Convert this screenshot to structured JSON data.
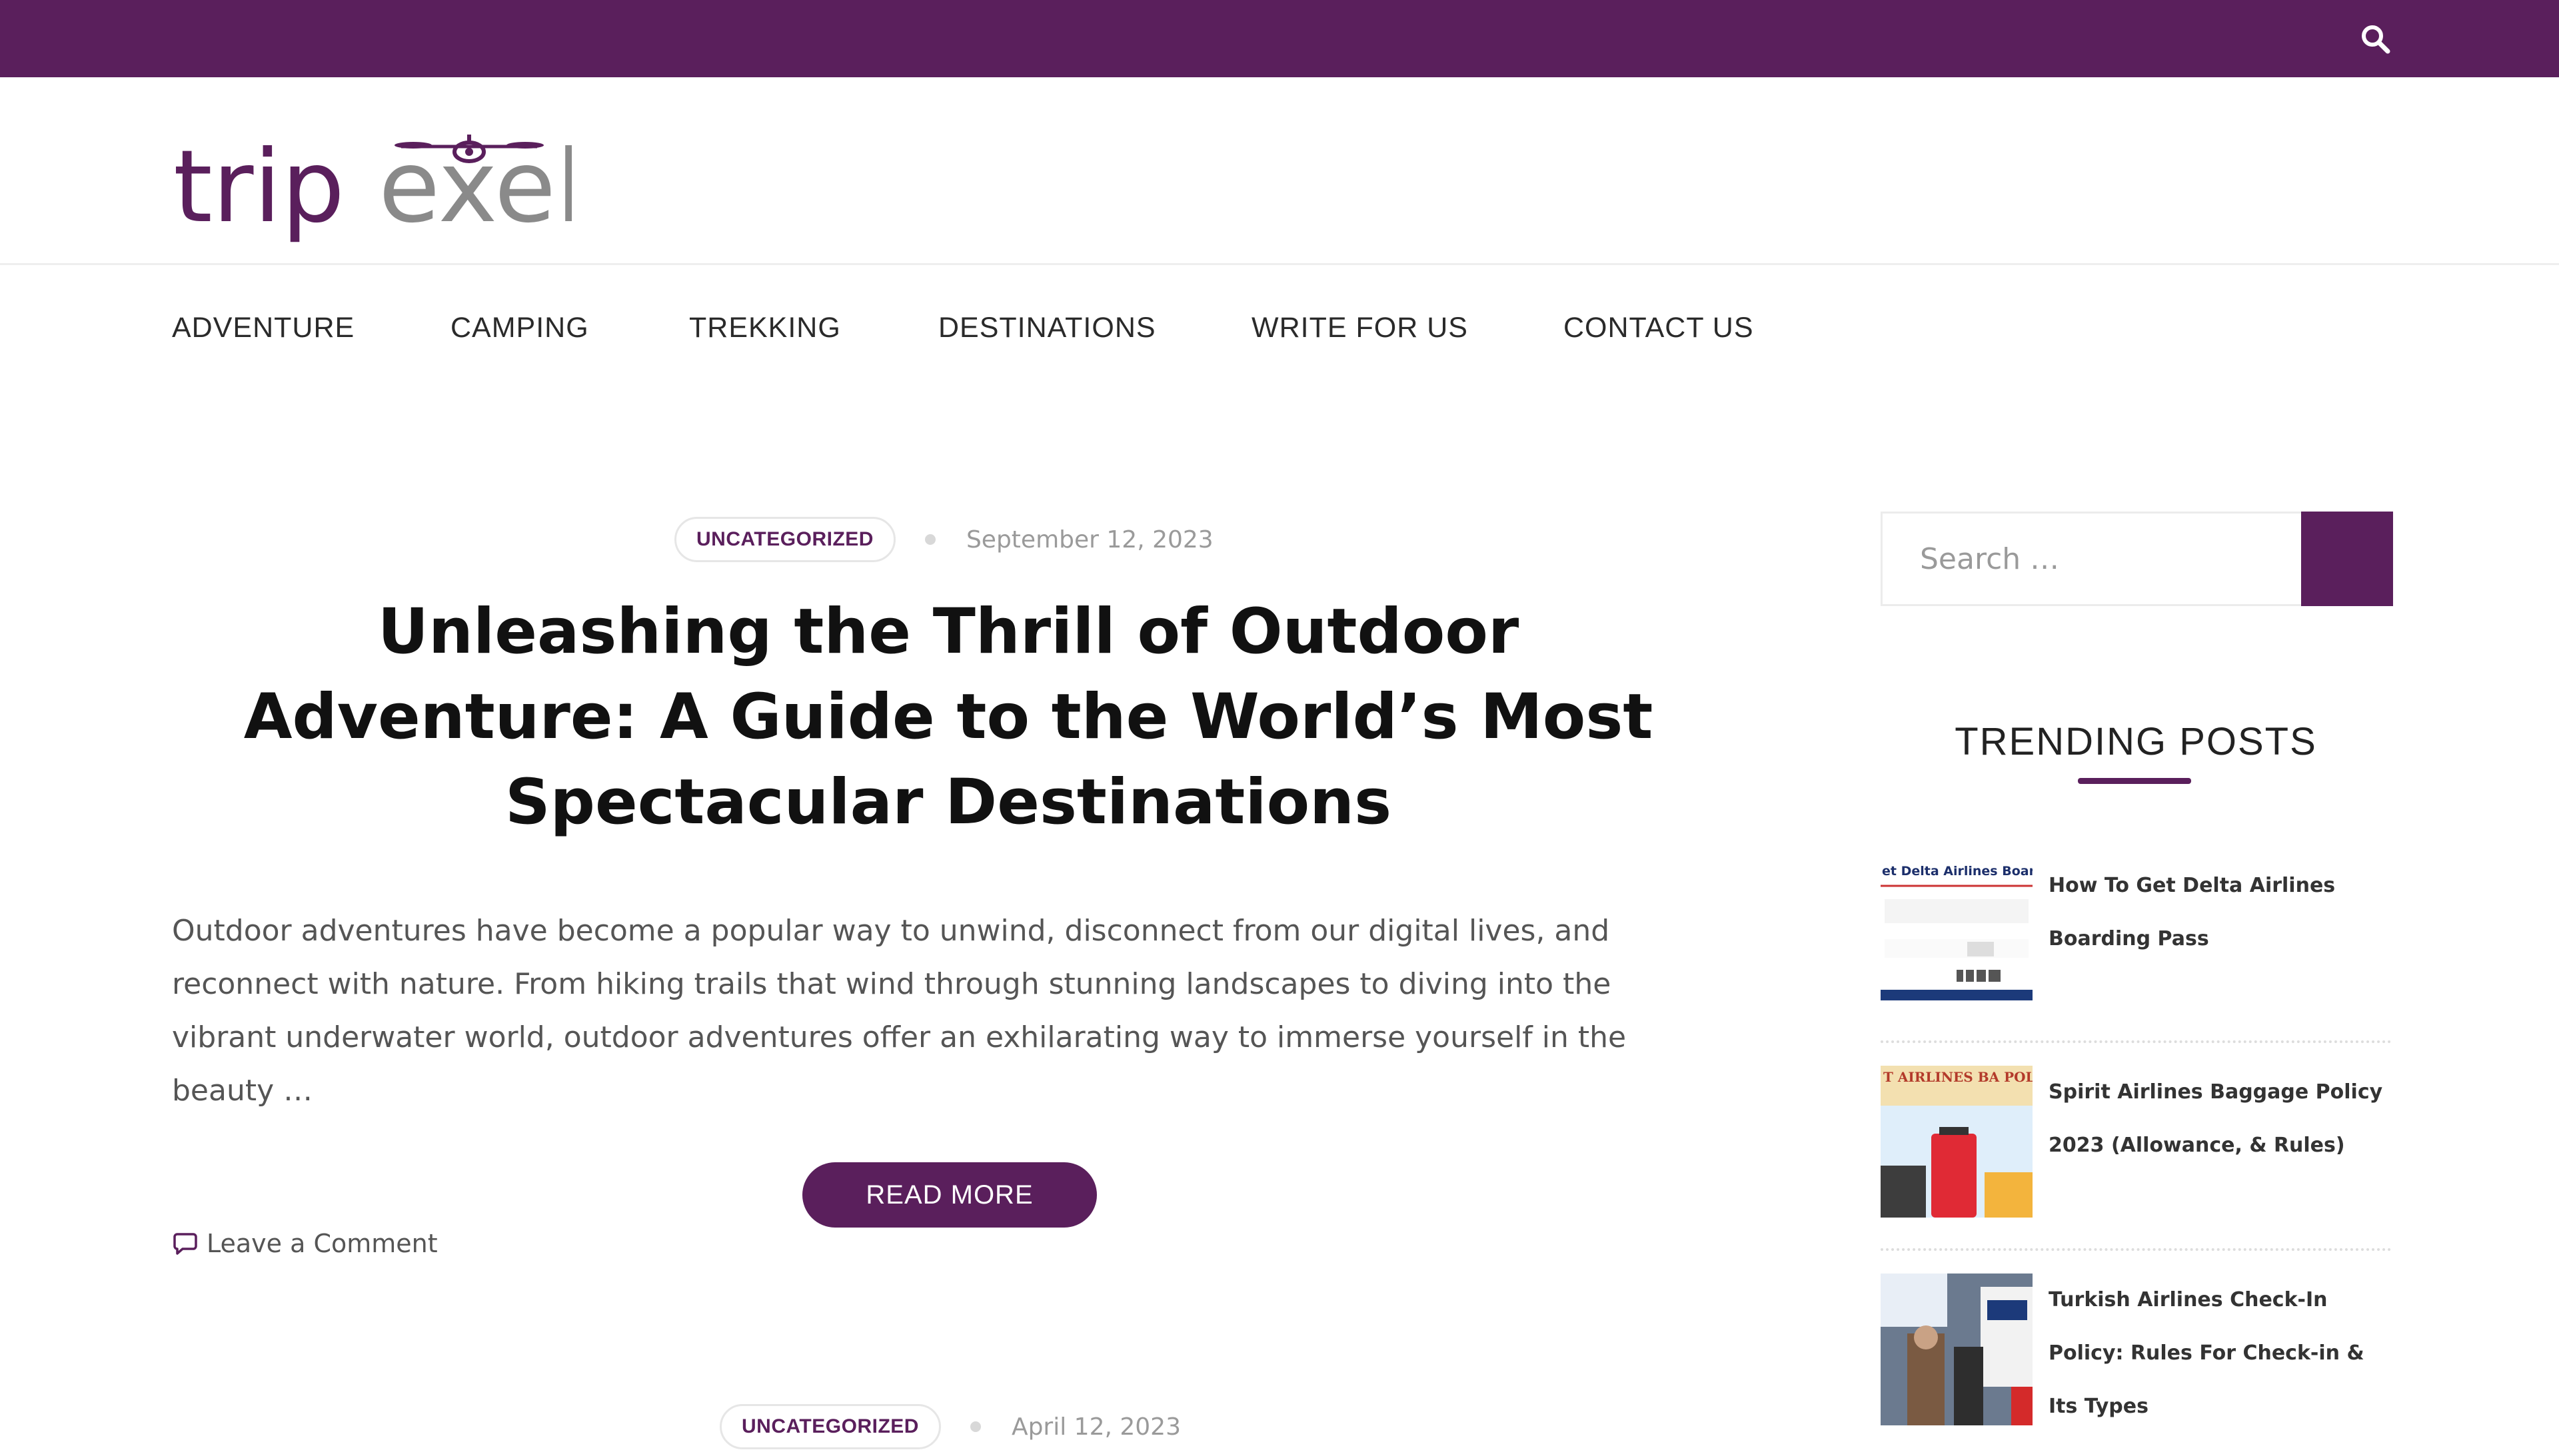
{
  "topbar": {
    "search_icon": "search-icon",
    "bg_color": "#5a1f5c"
  },
  "logo": {
    "part1": "trip",
    "part2": "exel",
    "part1_color": "#5a1f5c",
    "part2_color": "#8a8a8a"
  },
  "nav": {
    "items": [
      {
        "label": "ADVENTURE"
      },
      {
        "label": "CAMPING"
      },
      {
        "label": "TREKKING"
      },
      {
        "label": "DESTINATIONS"
      },
      {
        "label": "WRITE FOR US"
      },
      {
        "label": "CONTACT US"
      }
    ]
  },
  "post": {
    "category": "UNCATEGORIZED",
    "date": "September 12, 2023",
    "title_lines": [
      "Unleashing the Thrill of Outdoor",
      "Adventure: A Guide to the World’s Most",
      "Spectacular Destinations"
    ],
    "excerpt": "Outdoor adventures have become a popular way to unwind, disconnect from our digital lives, and reconnect with nature. From hiking trails that wind through stunning landscapes to diving into the vibrant underwater world, outdoor adventures offer an exhilarating way to immerse yourself in the beauty …",
    "read_more": "READ MORE",
    "comment": "Leave a Comment"
  },
  "next_post": {
    "category": "UNCATEGORIZED",
    "date": "April 12, 2023"
  },
  "sidebar": {
    "search": {
      "placeholder": "Search …",
      "value": ""
    },
    "trending_title": "TRENDING POSTS",
    "trending": [
      {
        "title": "How To Get Delta Airlines Boarding Pass",
        "thumb_text": "et Delta Airlines Boar"
      },
      {
        "title": "Spirit Airlines Baggage Policy 2023 (Allowance, & Rules)",
        "thumb_text": "T AIRLINES BA POLICY"
      },
      {
        "title": "Turkish Airlines Check-In Policy: Rules For Check-in & Its Types",
        "thumb_text": ""
      }
    ]
  },
  "colors": {
    "accent": "#5a1f5c"
  }
}
